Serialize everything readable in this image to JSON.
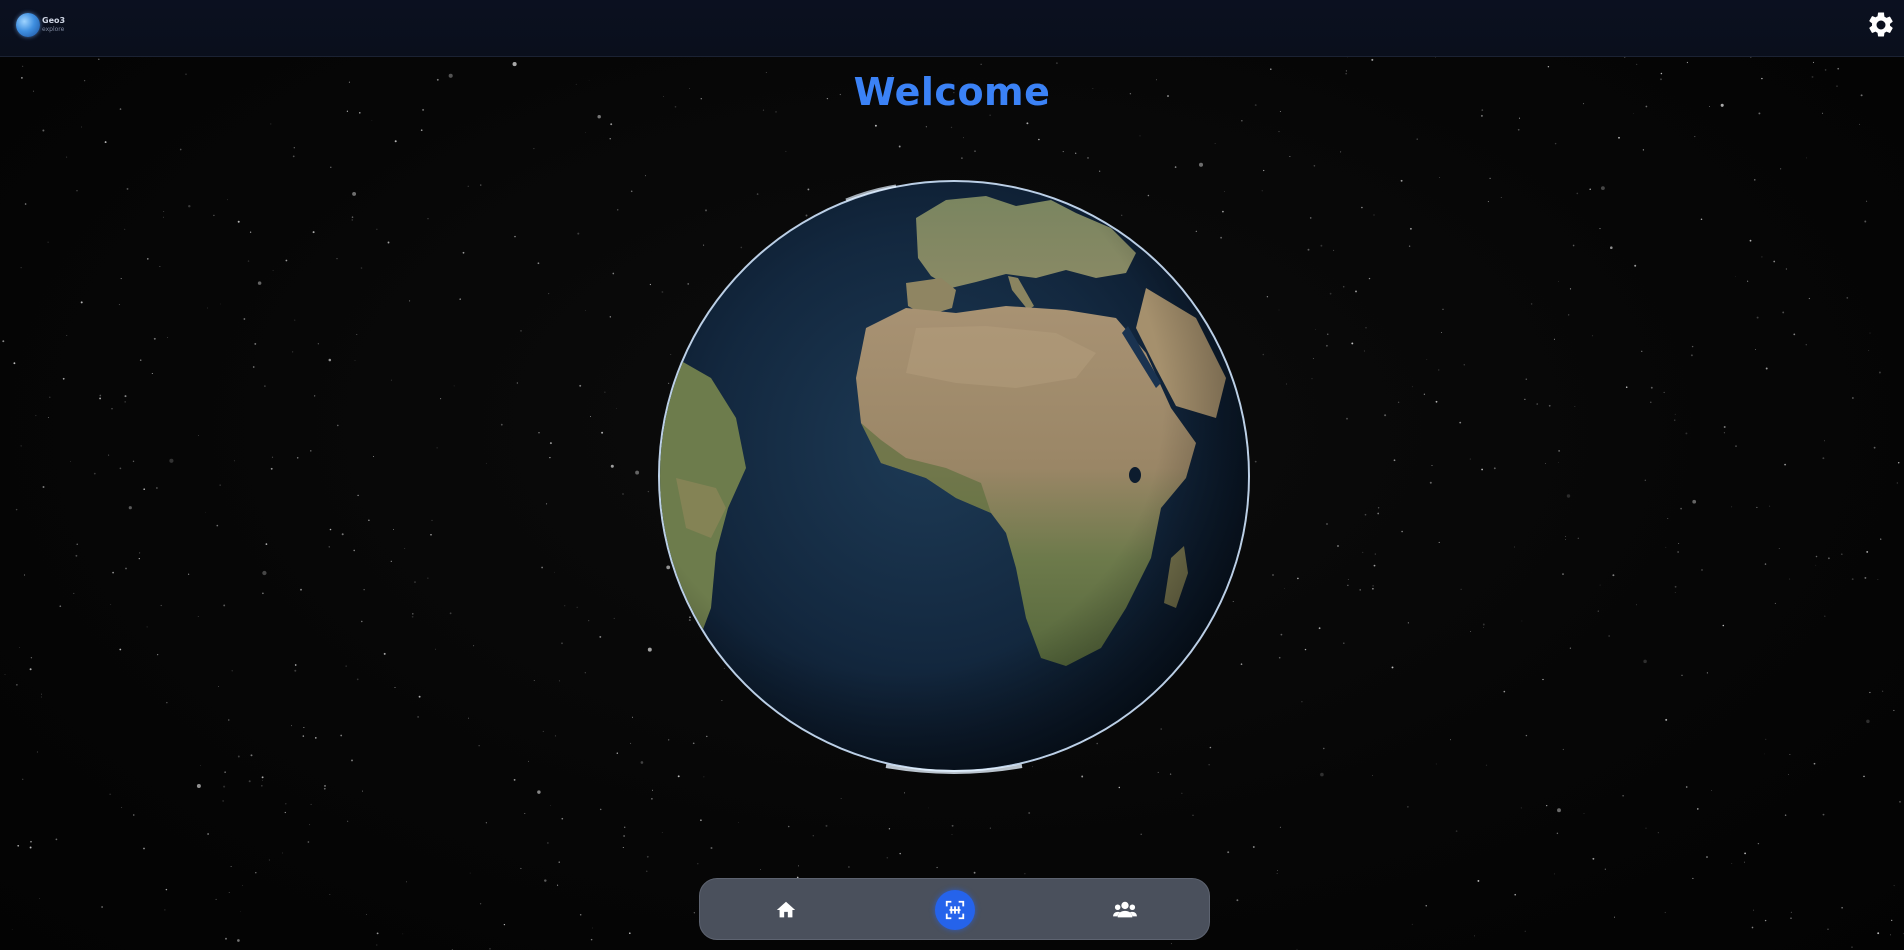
{
  "header": {
    "logo": {
      "icon": "globe-logo-icon",
      "line1": "Geo3",
      "line2": "explore"
    },
    "settings_icon": "gear-icon"
  },
  "main": {
    "title": "Welcome",
    "globe": "earth-globe-image"
  },
  "bottom_nav": {
    "items": [
      {
        "icon": "home-icon",
        "active": false
      },
      {
        "icon": "scan-icon",
        "active": true
      },
      {
        "icon": "users-icon",
        "active": false
      }
    ]
  },
  "colors": {
    "accent": "#3b82f6",
    "active_nav": "#2563eb",
    "nav_bar": "#4a505c",
    "header_bg": "#0b1020",
    "background": "#050505"
  }
}
